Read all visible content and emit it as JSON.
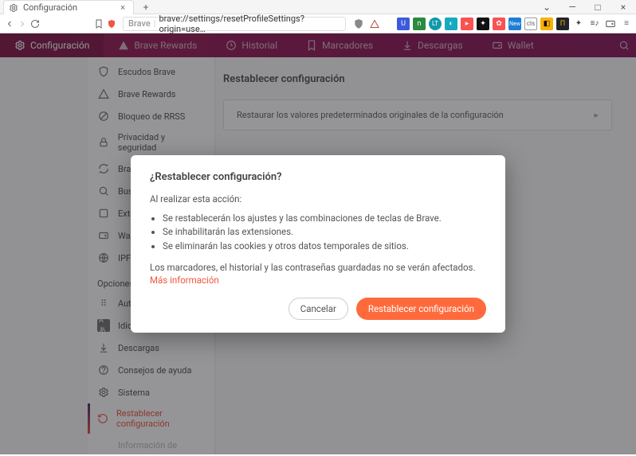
{
  "window": {
    "tab_title": "Configuración",
    "new_tab_glyph": "+",
    "close_glyph": "×",
    "min_glyph": "—",
    "max_glyph": "□",
    "dropdown_glyph": "⌄"
  },
  "urlbar": {
    "brand": "Brave",
    "path": "brave://settings/resetProfileSettings?origin=use…"
  },
  "brave_nav": {
    "items": [
      {
        "label": "Configuración",
        "icon": "gear"
      },
      {
        "label": "Brave Rewards",
        "icon": "triangle"
      },
      {
        "label": "Historial",
        "icon": "clock"
      },
      {
        "label": "Marcadores",
        "icon": "bookmark"
      },
      {
        "label": "Descargas",
        "icon": "download"
      },
      {
        "label": "Wallet",
        "icon": "wallet"
      }
    ]
  },
  "sidebar": {
    "items_top": [
      {
        "label": "Escudos Brave",
        "icon": "shield"
      },
      {
        "label": "Brave Rewards",
        "icon": "triangle"
      },
      {
        "label": "Bloqueo de RRSS",
        "icon": "block"
      },
      {
        "label": "Privacidad y seguridad",
        "icon": "lock"
      },
      {
        "label": "Brave Sync",
        "icon": "sync"
      },
      {
        "label": "Buscador",
        "icon": "search"
      },
      {
        "label": "Extensiones",
        "icon": "puzzle"
      },
      {
        "label": "Wallet",
        "icon": "wallet"
      },
      {
        "label": "IPFS",
        "icon": "globe"
      }
    ],
    "section_title": "Opciones adicionales",
    "items_bottom": [
      {
        "label": "Autocompletar",
        "icon": "list"
      },
      {
        "label": "Idiomas",
        "icon": "lang"
      },
      {
        "label": "Descargas",
        "icon": "download"
      },
      {
        "label": "Consejos de ayuda",
        "icon": "help"
      },
      {
        "label": "Sistema",
        "icon": "gear"
      },
      {
        "label": "Restablecer configuración",
        "icon": "reset",
        "active": true
      },
      {
        "label": "Información de",
        "icon": "info",
        "muted": true
      }
    ]
  },
  "main": {
    "heading": "Restablecer configuración",
    "card_text": "Restaurar los valores predeterminados originales de la configuración"
  },
  "dialog": {
    "title": "¿Restablecer configuración?",
    "intro": "Al realizar esta acción:",
    "bullets": [
      "Se restablecerán los ajustes y las combinaciones de teclas de Brave.",
      "Se inhabilitarán las extensiones.",
      "Se eliminarán las cookies y otros datos temporales de sitios."
    ],
    "footer_text": "Los marcadores, el historial y las contraseñas guardadas no se verán afectados. ",
    "more_info": "Más información",
    "cancel": "Cancelar",
    "confirm": "Restablecer configuración"
  },
  "colors": {
    "accent_orange": "#f0563f",
    "nav_magenta": "#9a1f57"
  }
}
